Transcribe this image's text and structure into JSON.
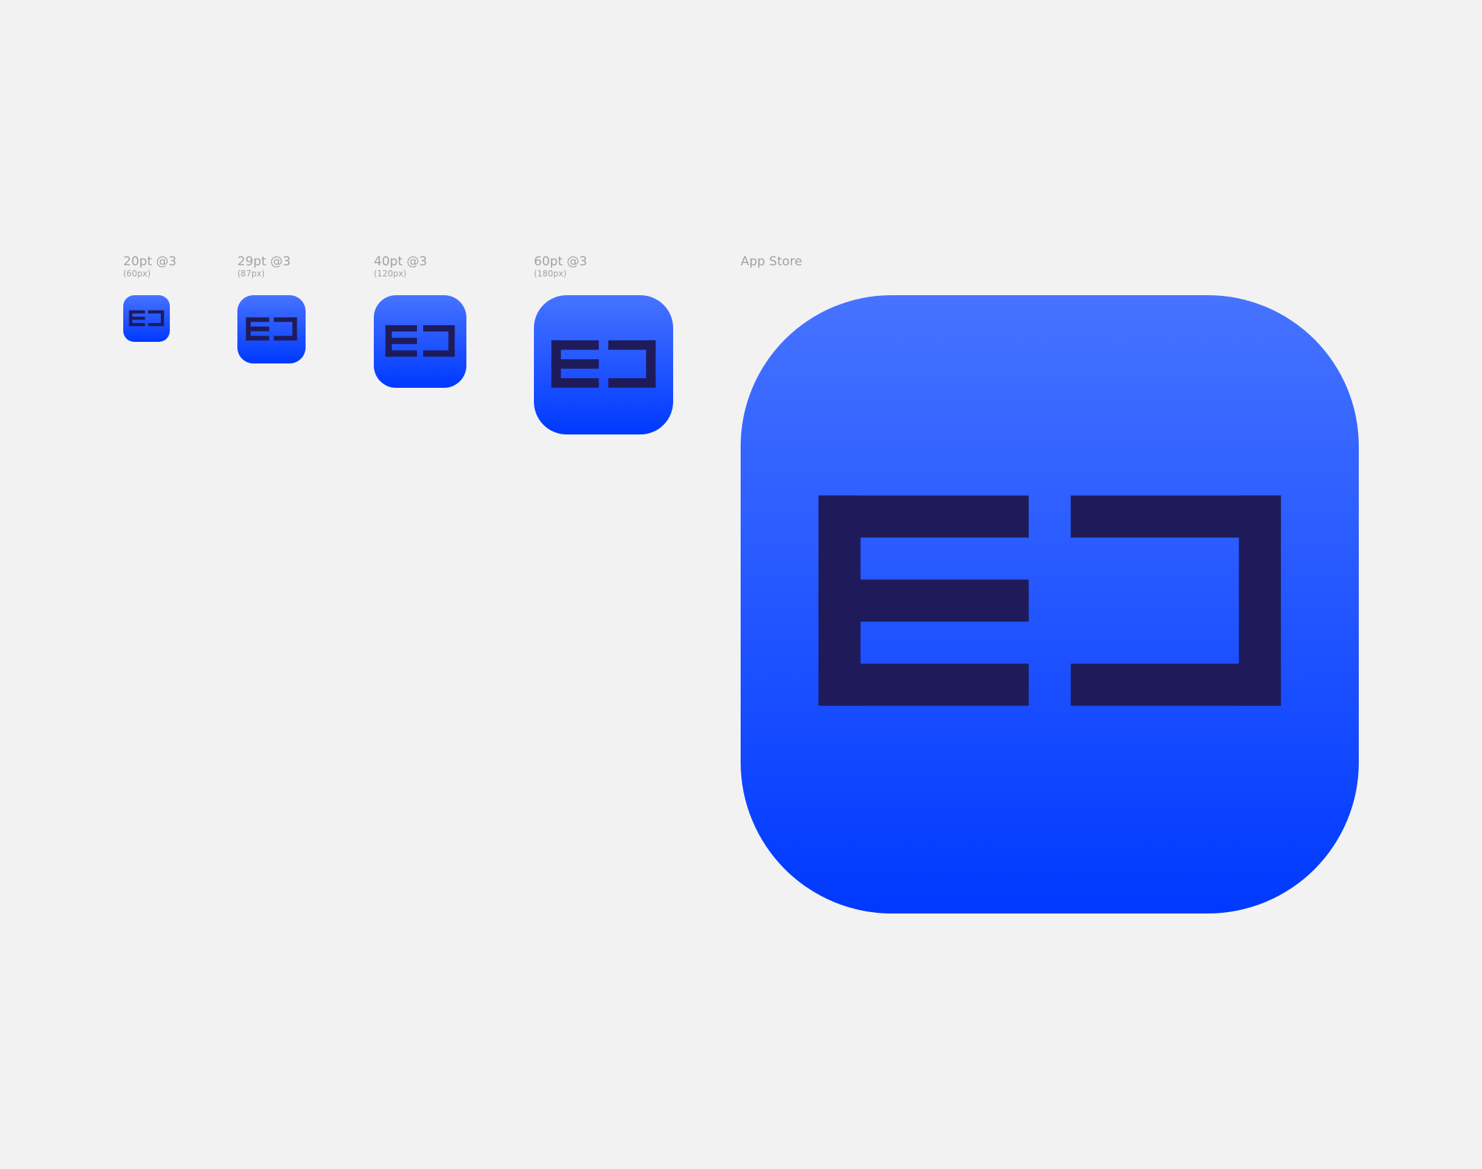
{
  "colors": {
    "background": "#f2f2f2",
    "tile_top": "#4673ff",
    "tile_bottom": "#0039ff",
    "glyph": "#1f1b5a",
    "label": "#a3a3a3"
  },
  "icons": [
    {
      "title": "20pt @3",
      "subtitle": "(60px)"
    },
    {
      "title": "29pt @3",
      "subtitle": "(87px)"
    },
    {
      "title": "40pt @3",
      "subtitle": "(120px)"
    },
    {
      "title": "60pt @3",
      "subtitle": "(180px)"
    },
    {
      "title": "App Store",
      "subtitle": ""
    }
  ],
  "logo": {
    "icon": "ec-monogram-icon"
  }
}
